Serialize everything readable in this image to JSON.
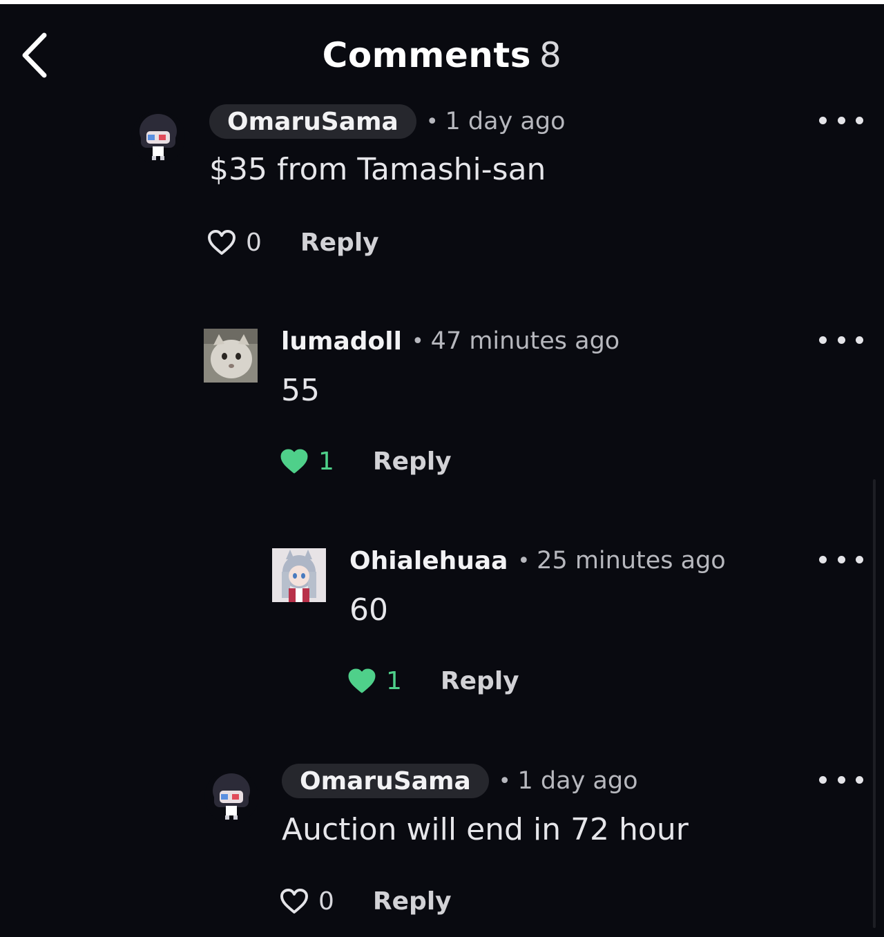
{
  "header": {
    "back_icon": "chevron-left-icon",
    "title": "Comments",
    "count": "8"
  },
  "comments": [
    {
      "author": "OmaruSama",
      "author_is_op": true,
      "dot": "•",
      "time": "1 day ago",
      "text": "$35 from Tamashi-san",
      "likes": "0",
      "liked": false,
      "reply_label": "Reply",
      "more_icon": "more-horizontal-icon"
    },
    {
      "author": "lumadoll",
      "author_is_op": false,
      "dot": "•",
      "time": "47 minutes ago",
      "text": "55",
      "likes": "1",
      "liked": true,
      "reply_label": "Reply",
      "more_icon": "more-horizontal-icon"
    },
    {
      "author": "Ohialehuaa",
      "author_is_op": false,
      "dot": "•",
      "time": "25 minutes ago",
      "text": "60",
      "likes": "1",
      "liked": true,
      "reply_label": "Reply",
      "more_icon": "more-horizontal-icon"
    },
    {
      "author": "OmaruSama",
      "author_is_op": true,
      "dot": "•",
      "time": "1 day ago",
      "text": "Auction will end in 72 hour",
      "likes": "0",
      "liked": false,
      "reply_label": "Reply",
      "more_icon": "more-horizontal-icon"
    }
  ],
  "colors": {
    "background": "#090a10",
    "liked": "#4fd08a",
    "pill": "#26272d",
    "muted": "#b7b8be"
  }
}
